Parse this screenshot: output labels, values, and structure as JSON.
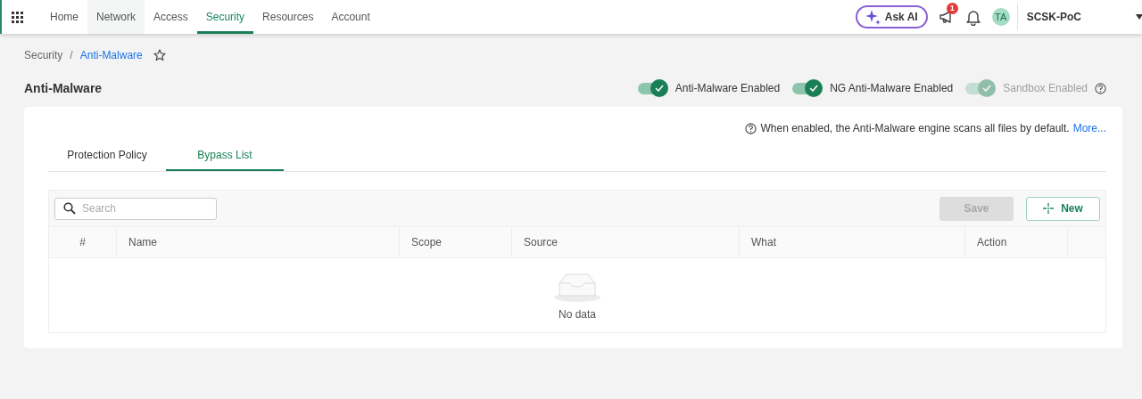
{
  "nav": {
    "tabs": [
      {
        "label": "Home",
        "selected": false,
        "hovered": false
      },
      {
        "label": "Network",
        "selected": false,
        "hovered": true
      },
      {
        "label": "Access",
        "selected": false,
        "hovered": false
      },
      {
        "label": "Security",
        "selected": true,
        "hovered": false
      },
      {
        "label": "Resources",
        "selected": false,
        "hovered": false
      },
      {
        "label": "Account",
        "selected": false,
        "hovered": false
      }
    ],
    "ask_ai": "Ask AI",
    "notification_badge": "1",
    "avatar": "TA",
    "tenant": "SCSK-PoC"
  },
  "breadcrumb": [
    "Security",
    "Anti-Malware"
  ],
  "breadcrumb_separator": "/",
  "page_title": "Anti-Malware",
  "toggles": [
    {
      "label": "Anti-Malware Enabled",
      "on": true,
      "disabled": false
    },
    {
      "label": "NG Anti-Malware Enabled",
      "on": true,
      "disabled": false
    },
    {
      "label": "Sandbox Enabled",
      "on": true,
      "disabled": true
    }
  ],
  "info": {
    "text": "When enabled, the Anti-Malware engine scans all files by default.",
    "link": "More..."
  },
  "tabs": [
    {
      "label": "Protection Policy",
      "selected": false
    },
    {
      "label": "Bypass List",
      "selected": true
    }
  ],
  "search": {
    "placeholder": "Search"
  },
  "buttons": [
    {
      "label": "Save",
      "disabled": true,
      "kind": "plain"
    },
    {
      "label": "New",
      "disabled": false,
      "kind": "add"
    }
  ],
  "table": {
    "columns": [
      "#",
      "Name",
      "Scope",
      "Source",
      "What",
      "Action"
    ],
    "empty_text": "No data"
  }
}
